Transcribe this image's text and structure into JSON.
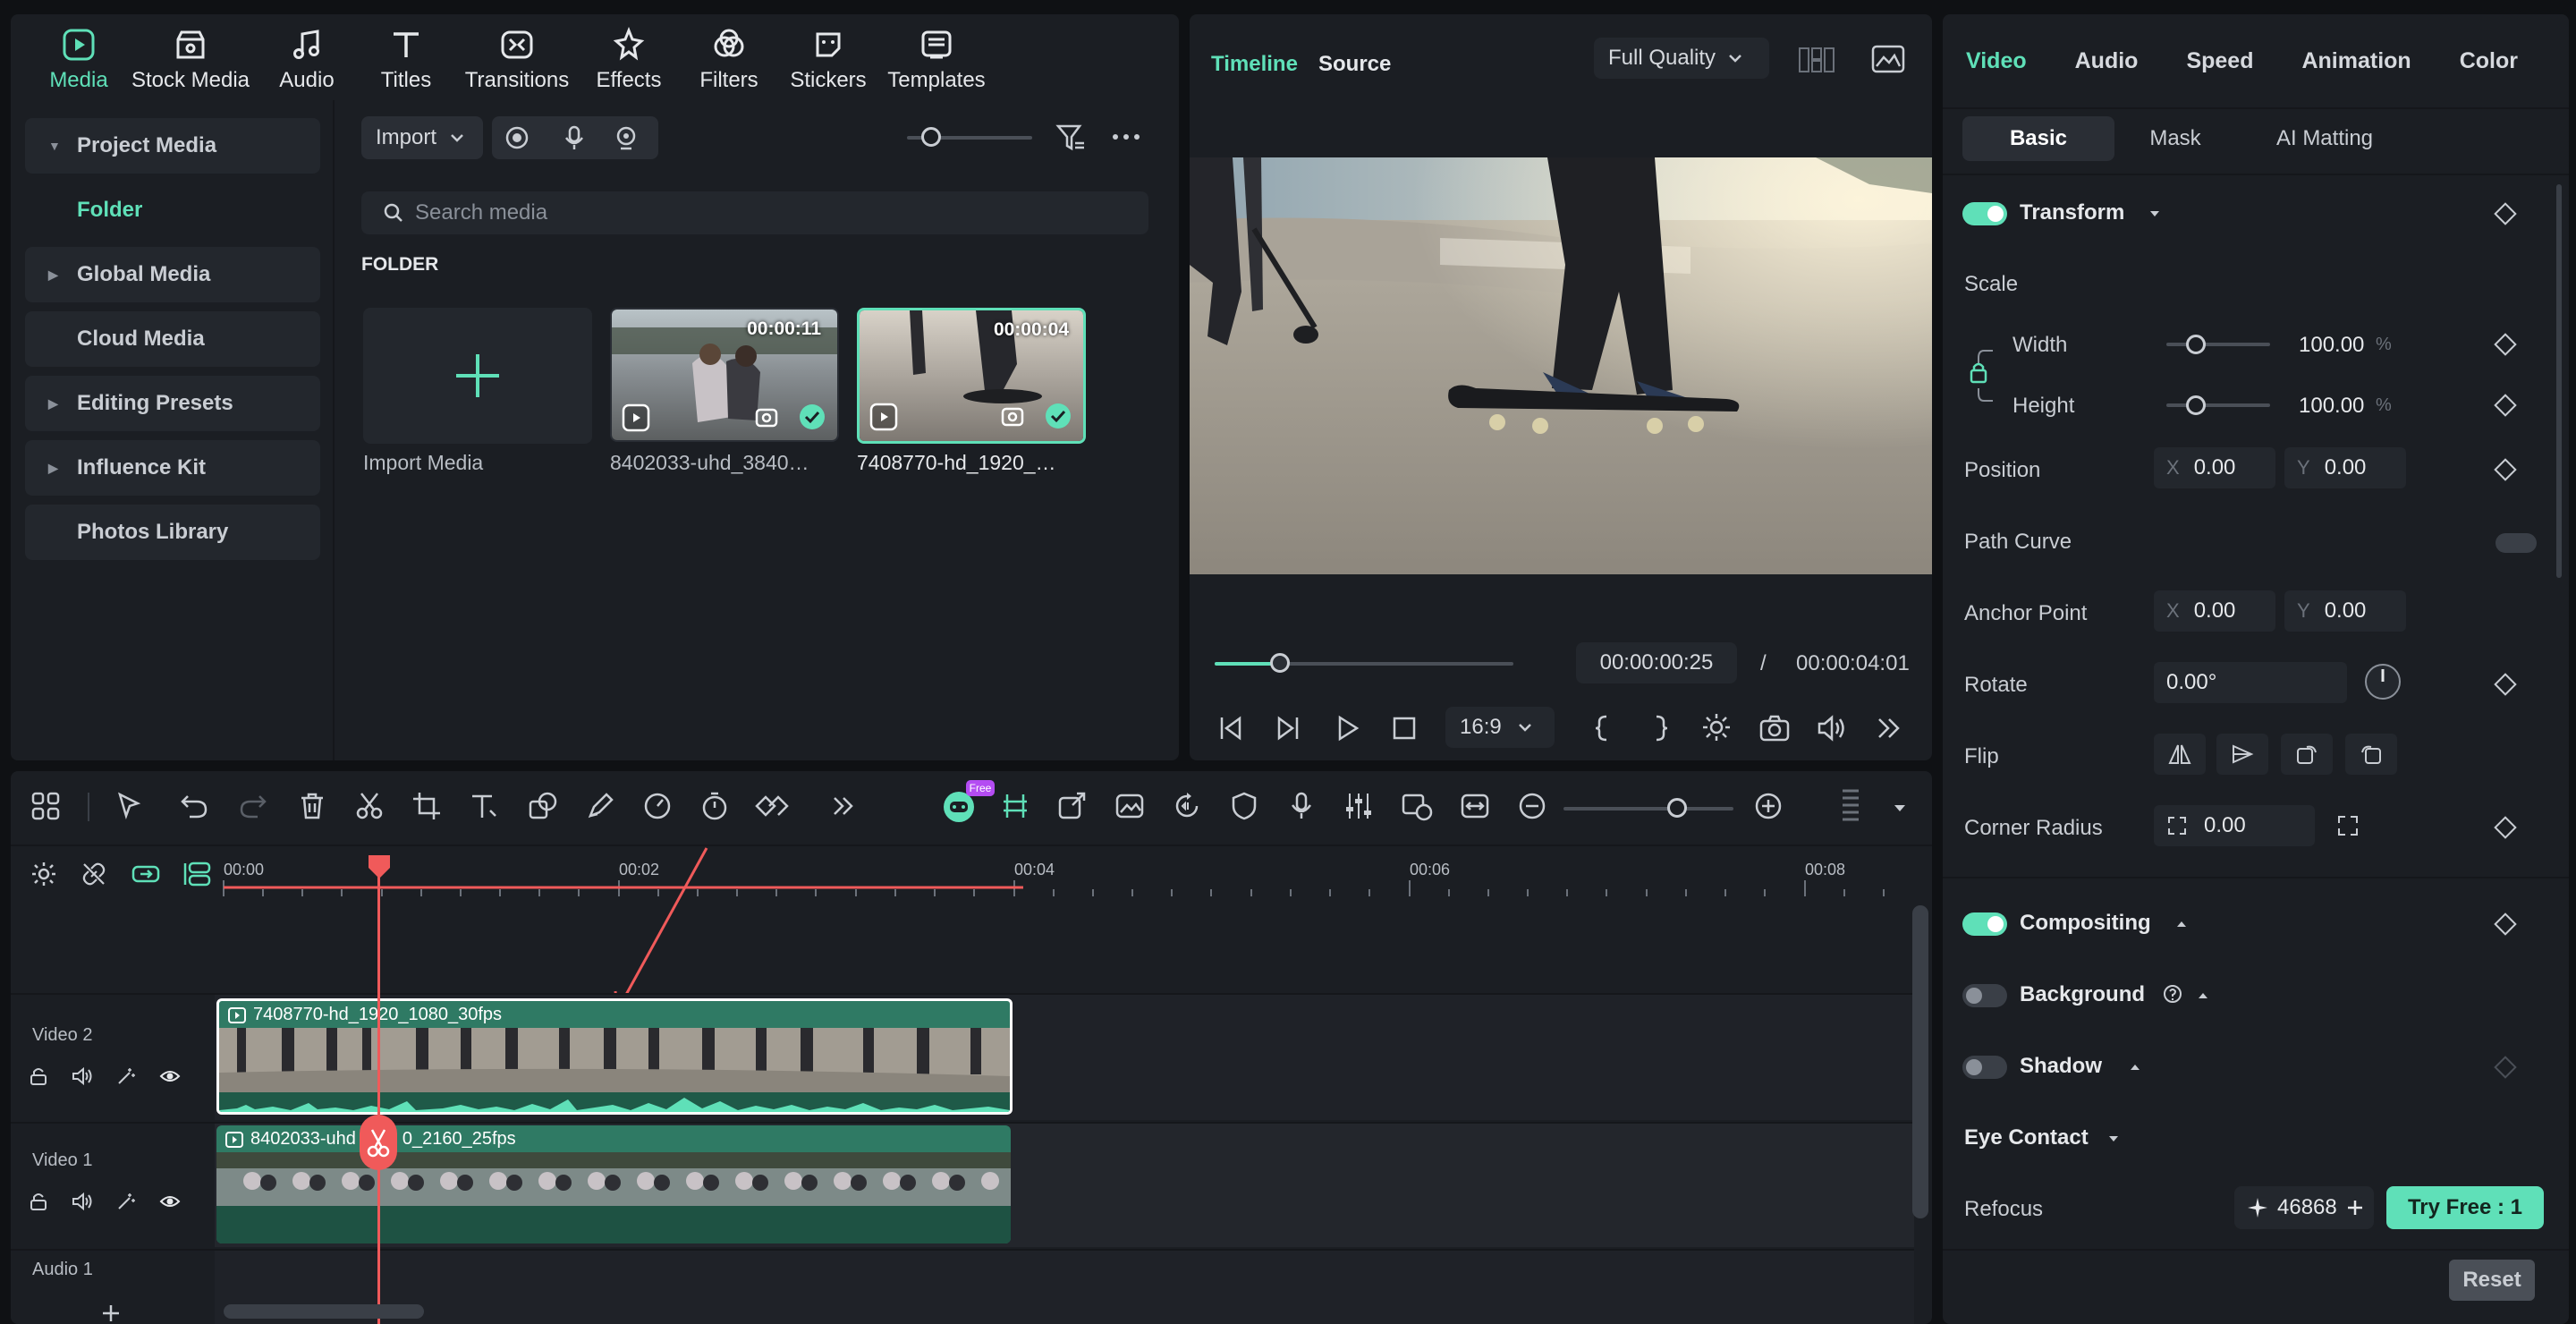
{
  "top_tabs": [
    {
      "label": "Media",
      "icon": "media-icon"
    },
    {
      "label": "Stock Media",
      "icon": "stock-media-icon"
    },
    {
      "label": "Audio",
      "icon": "music-note-icon"
    },
    {
      "label": "Titles",
      "icon": "text-icon"
    },
    {
      "label": "Transitions",
      "icon": "transitions-icon"
    },
    {
      "label": "Effects",
      "icon": "effects-icon"
    },
    {
      "label": "Filters",
      "icon": "filters-icon"
    },
    {
      "label": "Stickers",
      "icon": "stickers-icon"
    },
    {
      "label": "Templates",
      "icon": "templates-icon"
    }
  ],
  "sidebar": {
    "items": [
      {
        "label": "Project Media",
        "caret": "▼"
      },
      {
        "label": "Folder"
      },
      {
        "label": "Global Media",
        "caret": "▶"
      },
      {
        "label": "Cloud Media"
      },
      {
        "label": "Editing Presets",
        "caret": "▶"
      },
      {
        "label": "Influence Kit",
        "caret": "▶"
      },
      {
        "label": "Photos Library"
      }
    ]
  },
  "media": {
    "import_label": "Import",
    "search_placeholder": "Search media",
    "folder_heading": "FOLDER",
    "import_media_label": "Import Media",
    "items": [
      {
        "name": "8402033-uhd_3840…",
        "duration": "00:00:11"
      },
      {
        "name": "7408770-hd_1920_…",
        "duration": "00:00:04"
      }
    ]
  },
  "preview": {
    "tabs": [
      "Timeline",
      "Source"
    ],
    "quality": "Full Quality",
    "current_time": "00:00:00:25",
    "separator": "/",
    "total_time": "00:00:04:01",
    "aspect": "16:9",
    "progress": 0.22
  },
  "props": {
    "tabs": [
      "Video",
      "Audio",
      "Speed",
      "Animation",
      "Color"
    ],
    "subtabs": [
      "Basic",
      "Mask",
      "AI Matting"
    ],
    "transform": "Transform",
    "scale": "Scale",
    "width_label": "Width",
    "height_label": "Height",
    "width_value": "100.00",
    "height_value": "100.00",
    "percent": "%",
    "position": "Position",
    "x": "X",
    "y": "Y",
    "pos_x": "0.00",
    "pos_y": "0.00",
    "path_curve": "Path Curve",
    "anchor_point": "Anchor Point",
    "anchor_x": "0.00",
    "anchor_y": "0.00",
    "rotate": "Rotate",
    "rotate_value": "0.00°",
    "flip": "Flip",
    "corner_radius": "Corner Radius",
    "corner_value": "0.00",
    "compositing": "Compositing",
    "background": "Background",
    "shadow": "Shadow",
    "eye_contact": "Eye Contact",
    "refocus": "Refocus",
    "credits": "46868",
    "try_free": "Try Free : 1",
    "reset": "Reset"
  },
  "timeline": {
    "ruler": [
      "00:00",
      "00:02",
      "00:04",
      "00:06",
      "00:08"
    ],
    "badge": "Free",
    "tracks": [
      {
        "name": "Video 2",
        "clip": "7408770-hd_1920_1080_30fps"
      },
      {
        "name": "Video 1",
        "clip": "8402033-uhd_3840_2160_25fps",
        "clip_visible_a": "8402033-uhd",
        "clip_visible_b": "0_2160_25fps"
      },
      {
        "name": "Audio 1"
      }
    ]
  },
  "colors": {
    "accent": "#5fe0b8",
    "playhead": "#f05a5a",
    "clip_green": "#2f7a64"
  }
}
